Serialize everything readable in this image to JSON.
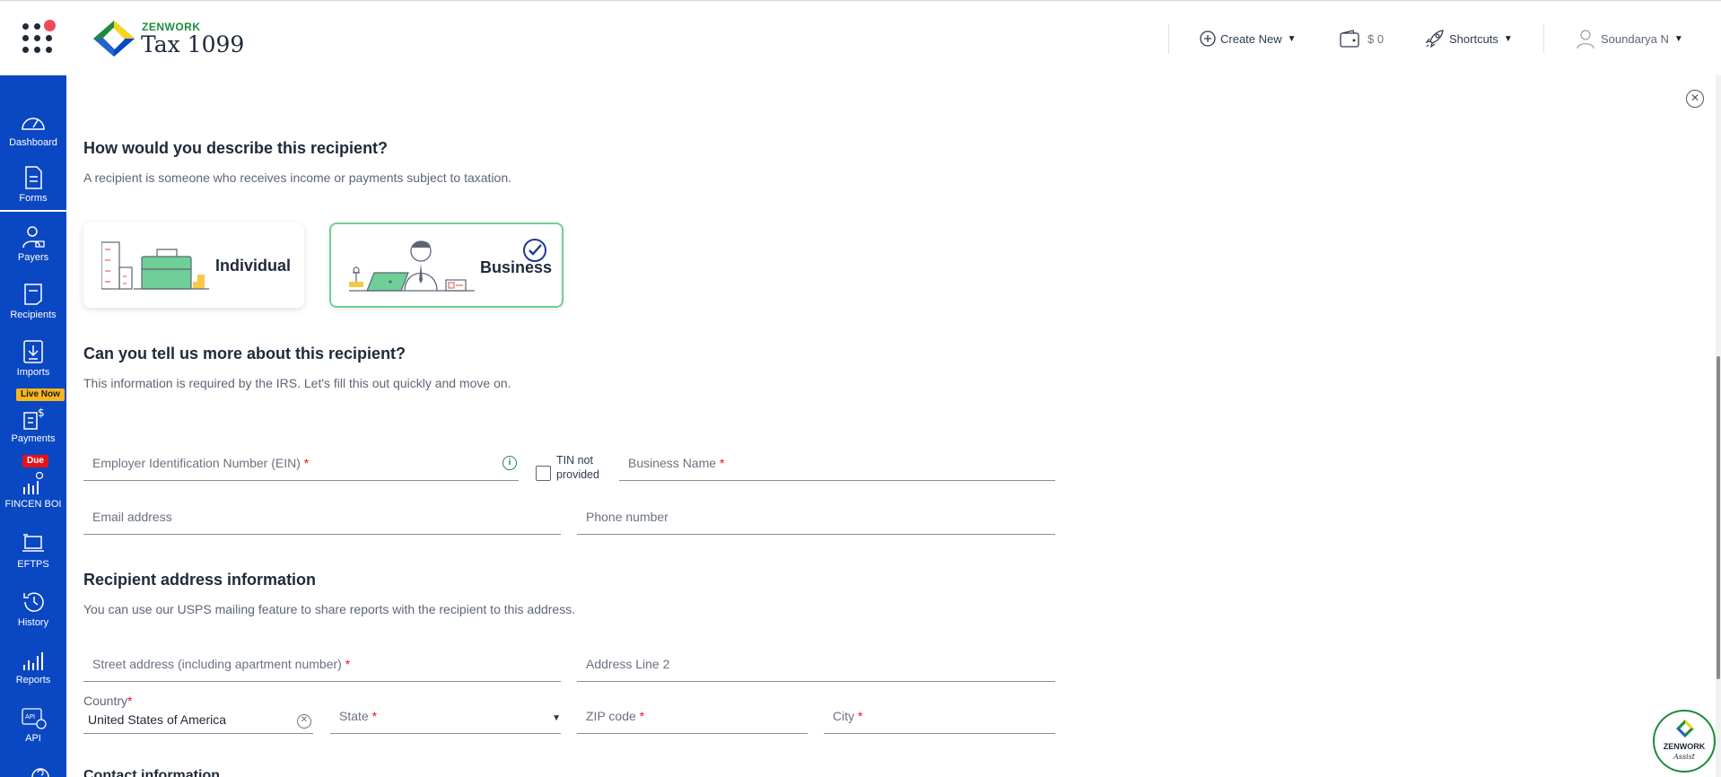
{
  "header": {
    "brand_small": "ZENWORK",
    "brand_big": "Tax 1099",
    "create_new": "Create New",
    "wallet": "$ 0",
    "shortcuts": "Shortcuts",
    "user": "Soundarya N"
  },
  "sidebar": {
    "items": [
      {
        "label": "Dashboard",
        "icon": "dashboard-icon"
      },
      {
        "label": "Forms",
        "icon": "forms-icon"
      },
      {
        "label": "Payers",
        "icon": "payers-icon"
      },
      {
        "label": "Recipients",
        "icon": "recipients-icon"
      },
      {
        "label": "Imports",
        "icon": "imports-icon"
      },
      {
        "label": "Payments",
        "icon": "payments-icon"
      },
      {
        "label": "FINCEN BOI",
        "icon": "fincen-icon"
      },
      {
        "label": "EFTPS",
        "icon": "eftps-icon"
      },
      {
        "label": "History",
        "icon": "history-icon"
      },
      {
        "label": "Reports",
        "icon": "reports-icon"
      },
      {
        "label": "API",
        "icon": "api-icon"
      }
    ],
    "badge_live": "Live Now",
    "badge_due": "Due"
  },
  "main": {
    "q1_title": "How would you describe this recipient?",
    "q1_sub": "A recipient is someone who receives income or payments subject to taxation.",
    "card_individual": "Individual",
    "card_business": "Business",
    "q2_title": "Can you tell us more about this recipient?",
    "q2_sub": "This information is required by the IRS. Let's fill this out quickly and move on.",
    "ein_placeholder": "Employer Identification Number (EIN)",
    "tin_line1": "TIN not",
    "tin_line2": "provided",
    "business_name": "Business Name",
    "email": "Email address",
    "phone": "Phone number",
    "addr_title": "Recipient address information",
    "addr_sub": "You can use our USPS mailing feature to share reports with the recipient to this address.",
    "street": "Street address (including apartment number)",
    "address2": "Address Line 2",
    "country_label": "Country",
    "country_value": "United States of America",
    "state": "State",
    "zip": "ZIP code",
    "city": "City",
    "required_mark": "*",
    "next_section_peek": "Contact information"
  },
  "assist": {
    "brand": "ZENWORK",
    "sub": "Assist"
  },
  "colors": {
    "sidebar": "#0a47c2",
    "brand_green": "#1c8b3d",
    "selected_border": "#6fcf97",
    "required": "#e4121b",
    "live_badge": "#f7b61b"
  }
}
